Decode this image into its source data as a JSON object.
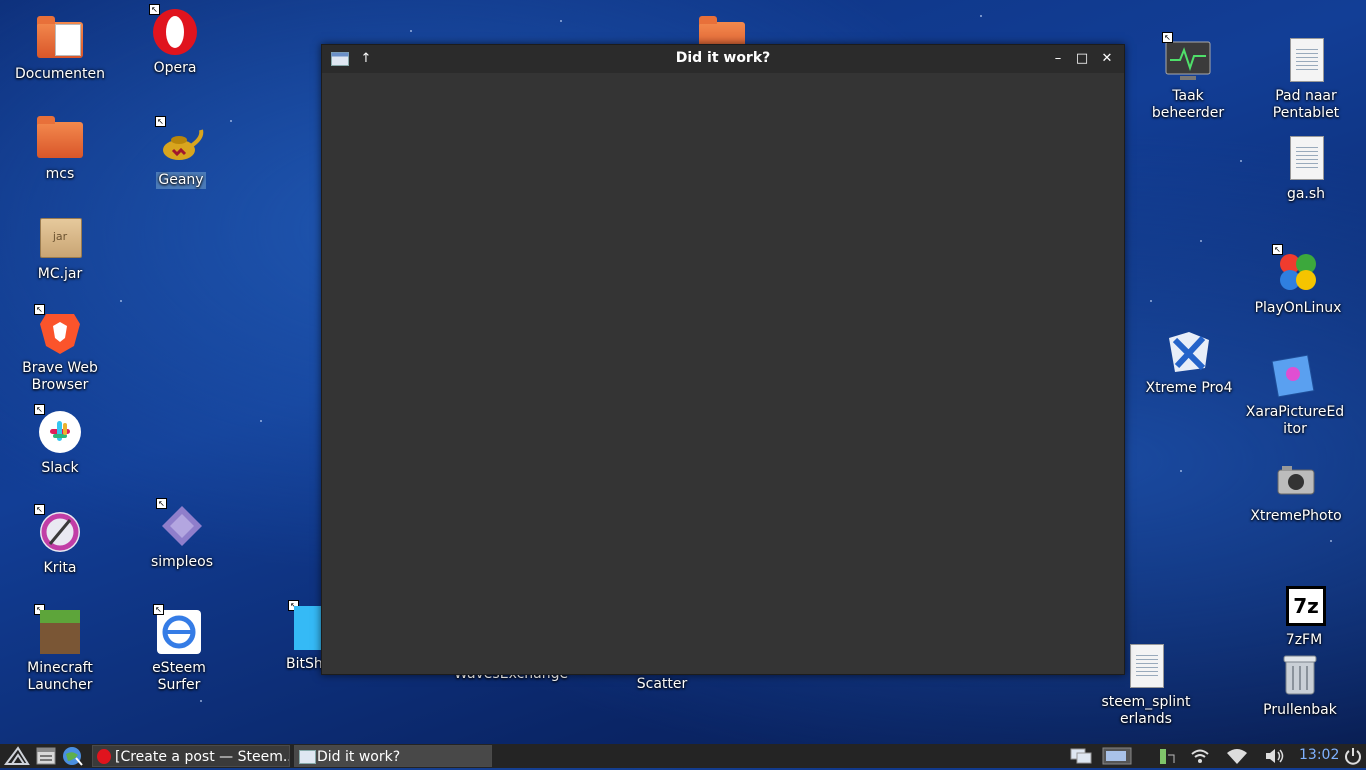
{
  "desktop_icons": {
    "documenten": "Documenten",
    "mcs": "mcs",
    "mc_jar": "MC.jar",
    "jar_badge": "jar",
    "brave": "Brave Web Browser",
    "slack": "Slack",
    "krita": "Krita",
    "minecraft": "Minecraft Launcher",
    "opera": "Opera",
    "geany": "Geany",
    "simpleos": "simpleos",
    "esteem": "eSteem Surfer",
    "bitshares": "BitShares",
    "wavesexchange": "WavesExchange",
    "scatter": "Scatter",
    "taak": "Taak beheerder",
    "pad_naar": "Pad naar Pentablet",
    "gash": "ga.sh",
    "playonlinux": "PlayOnLinux",
    "xtreme_pro": "Xtreme Pro4",
    "xara": "XaraPictureEditor",
    "xtreme_photo": "XtremePhoto",
    "sevenzip": "7zFM",
    "sevenzip_badge": "7z",
    "steem_splinter": "steem_splinterlands",
    "trash": "Prullenbak"
  },
  "window": {
    "title": "Did it work?",
    "up_glyph": "↑",
    "min_glyph": "–",
    "max_glyph": "□",
    "close_glyph": "✕"
  },
  "taskbar": {
    "tasks": [
      {
        "label": "[Create a post — Steem..."
      },
      {
        "label": "Did it work?"
      }
    ],
    "clock": "13:02"
  },
  "colors": {
    "window_bg": "#343434",
    "titlebar_bg": "#2b2b2b",
    "taskbar_bg": "#242424",
    "clock": "#7fb2ff",
    "desktop_blue": "#123e96"
  }
}
